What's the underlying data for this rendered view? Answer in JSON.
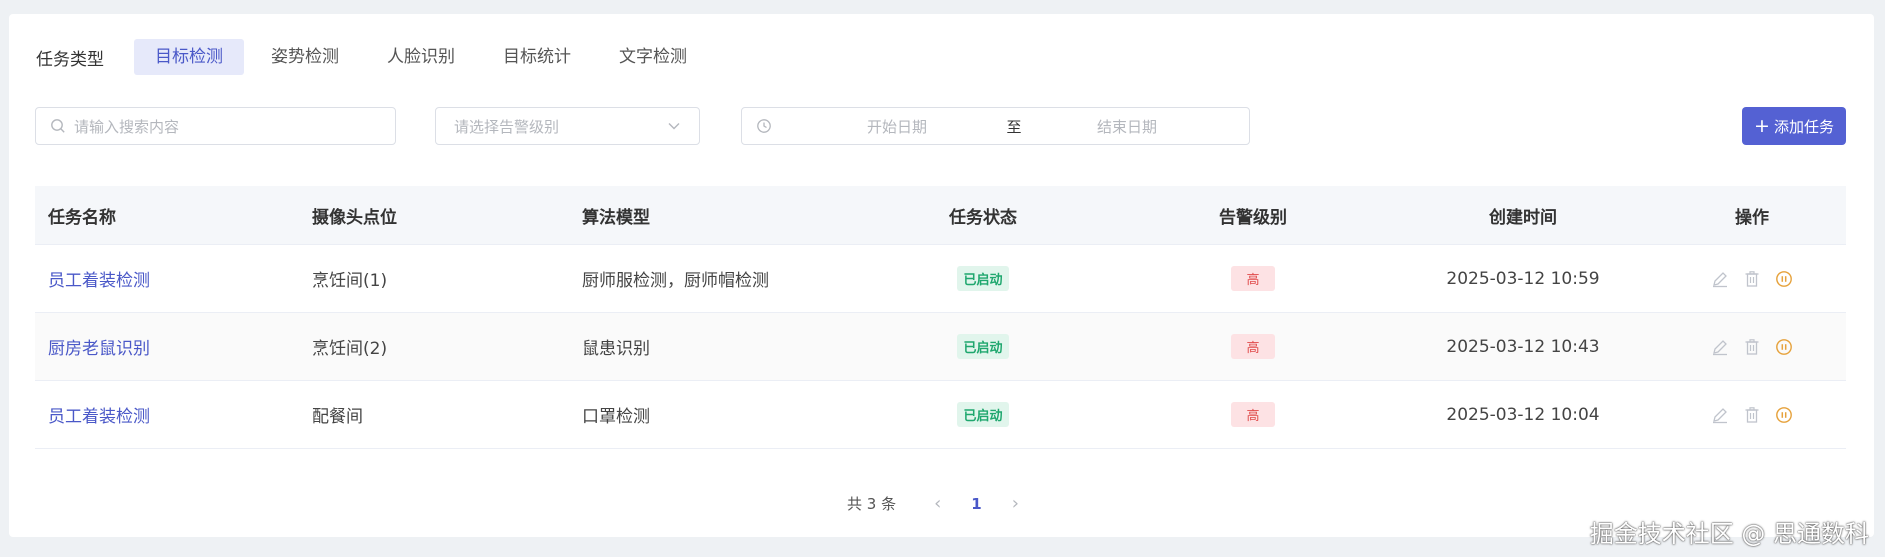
{
  "filters": {
    "label": "任务类型",
    "tabs": [
      {
        "label": "目标检测",
        "active": true
      },
      {
        "label": "姿势检测",
        "active": false
      },
      {
        "label": "人脸识别",
        "active": false
      },
      {
        "label": "目标统计",
        "active": false
      },
      {
        "label": "文字检测",
        "active": false
      }
    ]
  },
  "search": {
    "placeholder": "请输入搜索内容"
  },
  "alert_select": {
    "placeholder": "请选择告警级别"
  },
  "date_range": {
    "start_placeholder": "开始日期",
    "separator": "至",
    "end_placeholder": "结束日期"
  },
  "add_button": {
    "label": "添加任务"
  },
  "table": {
    "headers": [
      "任务名称",
      "摄像头点位",
      "算法模型",
      "任务状态",
      "告警级别",
      "创建时间",
      "操作"
    ],
    "rows": [
      {
        "name": "员工着装检测",
        "camera": "烹饪间(1)",
        "model": "厨师服检测，厨师帽检测",
        "status": "已启动",
        "level": "高",
        "created": "2025-03-12 10:59"
      },
      {
        "name": "厨房老鼠识别",
        "camera": "烹饪间(2)",
        "model": "鼠患识别",
        "status": "已启动",
        "level": "高",
        "created": "2025-03-12 10:43"
      },
      {
        "name": "员工着装检测",
        "camera": "配餐间",
        "model": "口罩检测",
        "status": "已启动",
        "level": "高",
        "created": "2025-03-12 10:04"
      }
    ]
  },
  "pagination": {
    "total_text": "共 3 条",
    "current_page": "1"
  },
  "watermark": "掘金技术社区 @ 思通数科",
  "colors": {
    "accent": "#5461d3",
    "status_green": "#1fa76e",
    "level_red": "#e04a4a"
  }
}
